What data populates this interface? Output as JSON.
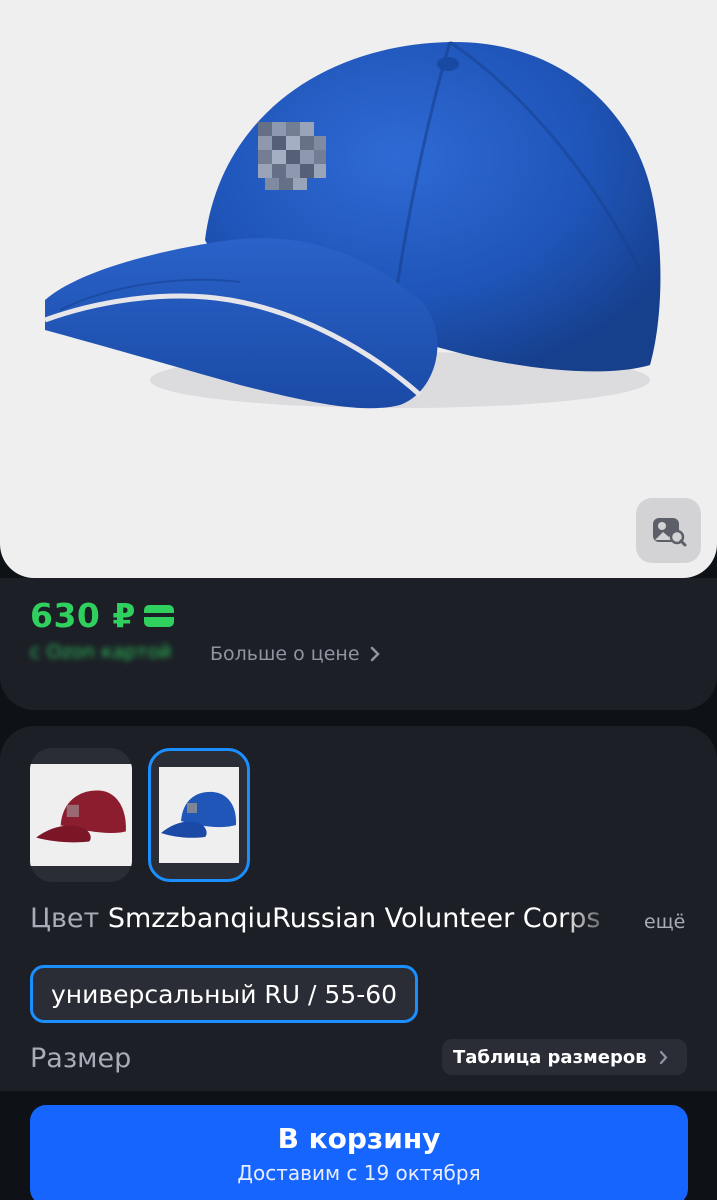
{
  "product": {
    "image_alt": "blue baseball cap",
    "image_search_icon": "image-search-icon"
  },
  "price": {
    "value": "630 ₽",
    "card_icon": "card-icon",
    "promo_text": "с Ozon картой",
    "more_label": "Больше о цене",
    "accent_color": "#2fd05e"
  },
  "variants": {
    "thumbnails": [
      {
        "name": "red-cap",
        "color": "#8b1d2e"
      },
      {
        "name": "blue-cap",
        "color": "#1f56b8",
        "selected": true
      }
    ],
    "color_label": "Цвет",
    "color_value": "SmzzbanqiuRussian Volunteer Corps",
    "more_label": "ещё",
    "selected_size": "универсальный RU / 55-60",
    "size_label": "Размер",
    "size_table_label": "Таблица размеров",
    "accent_color": "#1b8fff"
  },
  "cart": {
    "button_label": "В корзину",
    "delivery_text": "Доставим с 19 октября",
    "color": "#1765ff"
  }
}
